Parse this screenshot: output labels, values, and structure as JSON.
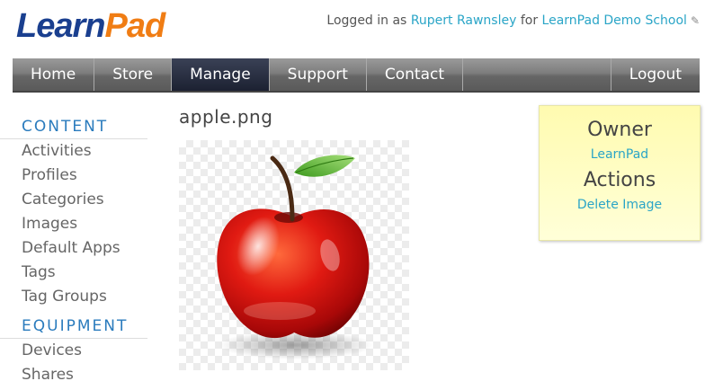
{
  "logo": {
    "part1": "Learn",
    "part2": "Pad"
  },
  "login": {
    "prefix": "Logged in as",
    "user": "Rupert Rawnsley",
    "middle": "for",
    "school": "LearnPad Demo School"
  },
  "nav": {
    "items": [
      "Home",
      "Store",
      "Manage",
      "Support",
      "Contact"
    ],
    "active": "Manage",
    "logout": "Logout"
  },
  "sidebar": {
    "content_heading": "CONTENT",
    "content_items": [
      "Activities",
      "Profiles",
      "Categories",
      "Images",
      "Default Apps",
      "Tags",
      "Tag Groups"
    ],
    "equipment_heading": "EQUIPMENT",
    "equipment_items": [
      "Devices",
      "Shares"
    ]
  },
  "main": {
    "title": "apple.png"
  },
  "panel": {
    "owner_heading": "Owner",
    "owner_value": "LearnPad",
    "actions_heading": "Actions",
    "delete_label": "Delete Image"
  },
  "colors": {
    "accent": "#2aa5c7",
    "logo_blue": "#1a3f8f",
    "logo_orange": "#f07d14",
    "nav_active": "#1c2132"
  }
}
